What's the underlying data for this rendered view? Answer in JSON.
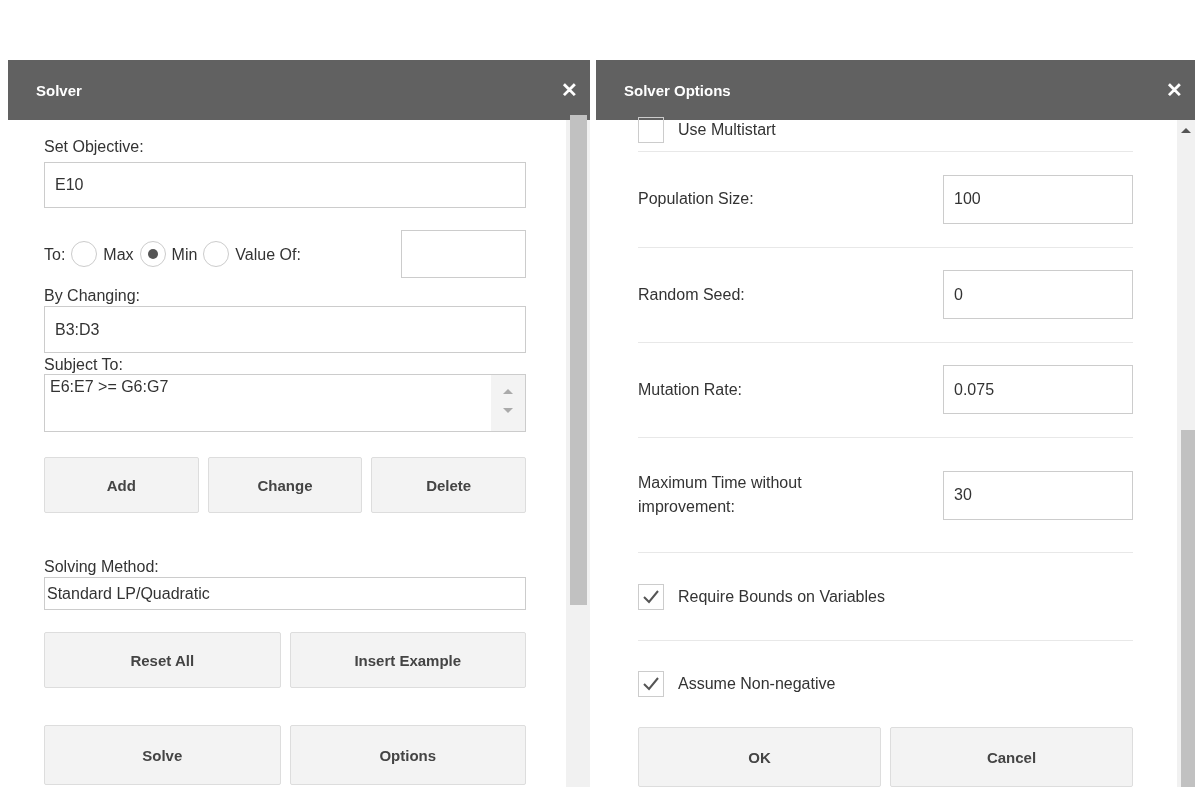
{
  "solver": {
    "title": "Solver",
    "close": "✕",
    "objective": {
      "label": "Set Objective:",
      "value": "E10"
    },
    "to": {
      "label": "To:",
      "options": [
        {
          "label": "Max",
          "selected": false
        },
        {
          "label": "Min",
          "selected": true
        },
        {
          "label": "Value Of:",
          "selected": false
        }
      ]
    },
    "changing": {
      "label": "By Changing:",
      "value": "B3:D3"
    },
    "subject": {
      "label": "Subject To:",
      "items": [
        "E6:E7 >= G6:G7"
      ]
    },
    "constraint_buttons": [
      "Add",
      "Change",
      "Delete"
    ],
    "method": {
      "label": "Solving Method:",
      "value": "Standard LP/Quadratic"
    },
    "action_buttons": [
      "Reset All",
      "Insert Example"
    ],
    "bottom_buttons": [
      "Solve",
      "Options"
    ]
  },
  "options": {
    "title": "Solver Options",
    "close": "✕",
    "rows": [
      {
        "kind": "checkbox",
        "label": "Use Multistart",
        "checked": false
      },
      {
        "kind": "field",
        "label": "Population Size:",
        "value": "100"
      },
      {
        "kind": "field",
        "label": "Random Seed:",
        "value": "0"
      },
      {
        "kind": "field",
        "label": "Mutation Rate:",
        "value": "0.075"
      },
      {
        "kind": "field",
        "label": "Maximum Time without improvement:",
        "value": "30"
      },
      {
        "kind": "checkbox",
        "label": "Require Bounds on Variables",
        "checked": true
      },
      {
        "kind": "checkbox",
        "label": "Assume Non-negative",
        "checked": true
      }
    ],
    "buttons": [
      "OK",
      "Cancel"
    ]
  }
}
